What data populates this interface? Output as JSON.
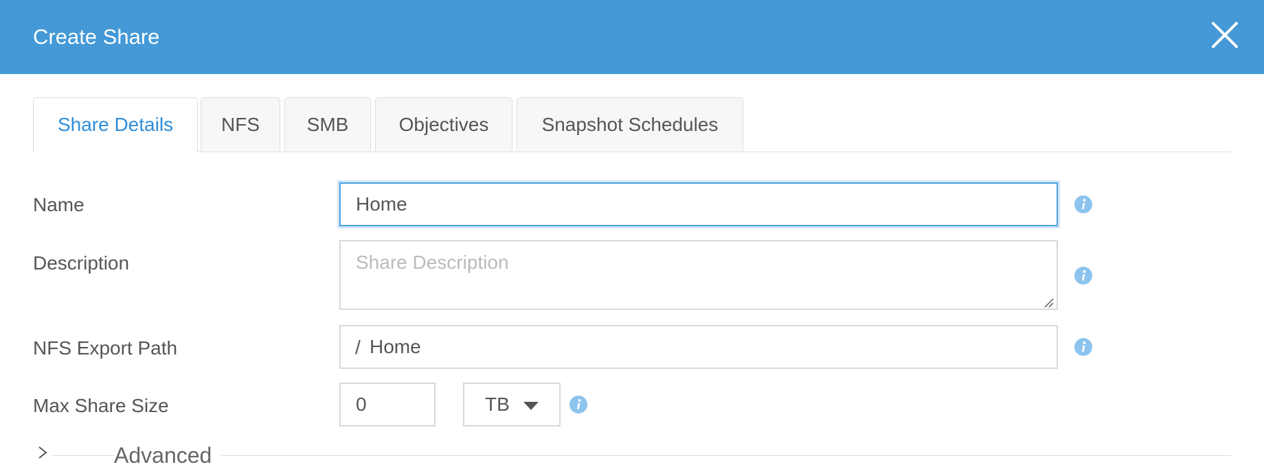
{
  "dialog": {
    "title": "Create Share",
    "close_icon": "close-icon"
  },
  "tabs": [
    {
      "label": "Share Details",
      "active": true
    },
    {
      "label": "NFS",
      "active": false
    },
    {
      "label": "SMB",
      "active": false
    },
    {
      "label": "Objectives",
      "active": false
    },
    {
      "label": "Snapshot Schedules",
      "active": false
    }
  ],
  "form": {
    "name": {
      "label": "Name",
      "value": "Home"
    },
    "description": {
      "label": "Description",
      "value": "",
      "placeholder": "Share Description"
    },
    "nfs_export_path": {
      "label": "NFS Export Path",
      "prefix": "/",
      "value": "Home"
    },
    "max_share_size": {
      "label": "Max Share Size",
      "value": "0",
      "unit": "TB"
    }
  },
  "advanced": {
    "label": "Advanced",
    "expanded": false
  },
  "colors": {
    "header": "#4499d6",
    "accent": "#2f8dd8",
    "info_icon": "#8cc4ee",
    "focus_border": "#4aa3e0"
  },
  "icons": {
    "info": "info-icon",
    "chevron": "chevron-right-icon",
    "dropdown": "caret-down-icon"
  }
}
